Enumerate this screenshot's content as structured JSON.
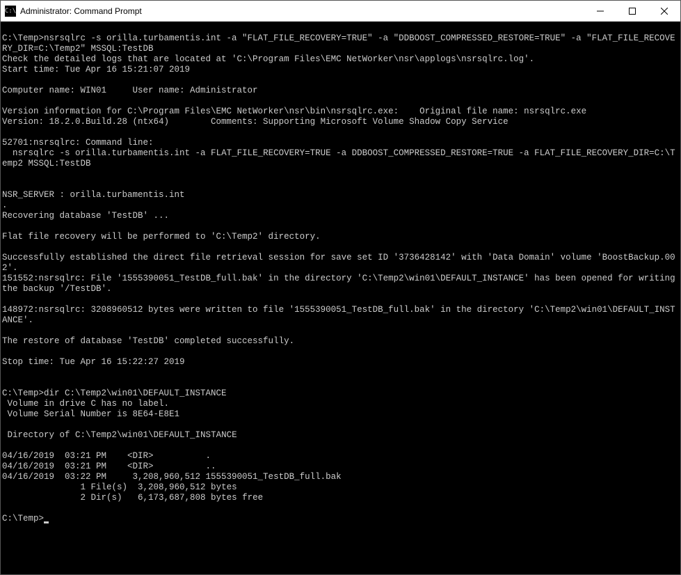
{
  "window": {
    "title": "Administrator: Command Prompt",
    "icon_label": "C:\\"
  },
  "terminal": {
    "lines": [
      "",
      "C:\\Temp>nsrsqlrc -s orilla.turbamentis.int -a \"FLAT_FILE_RECOVERY=TRUE\" -a \"DDBOOST_COMPRESSED_RESTORE=TRUE\" -a \"FLAT_FILE_RECOVERY_DIR=C:\\Temp2\" MSSQL:TestDB",
      "Check the detailed logs that are located at 'C:\\Program Files\\EMC NetWorker\\nsr\\applogs\\nsrsqlrc.log'.",
      "Start time: Tue Apr 16 15:21:07 2019",
      "",
      "Computer name: WIN01     User name: Administrator",
      "",
      "Version information for C:\\Program Files\\EMC NetWorker\\nsr\\bin\\nsrsqlrc.exe:    Original file name: nsrsqlrc.exe",
      "Version: 18.2.0.Build.28 (ntx64)        Comments: Supporting Microsoft Volume Shadow Copy Service",
      "",
      "52701:nsrsqlrc: Command line:",
      "  nsrsqlrc -s orilla.turbamentis.int -a FLAT_FILE_RECOVERY=TRUE -a DDBOOST_COMPRESSED_RESTORE=TRUE -a FLAT_FILE_RECOVERY_DIR=C:\\Temp2 MSSQL:TestDB",
      "",
      "",
      "NSR_SERVER : orilla.turbamentis.int",
      ".",
      "Recovering database 'TestDB' ...",
      "",
      "Flat file recovery will be performed to 'C:\\Temp2' directory.",
      "",
      "Successfully established the direct file retrieval session for save set ID '3736428142' with 'Data Domain' volume 'BoostBackup.002'.",
      "151552:nsrsqlrc: File '1555390051_TestDB_full.bak' in the directory 'C:\\Temp2\\win01\\DEFAULT_INSTANCE' has been opened for writing the backup '/TestDB'.",
      "",
      "148972:nsrsqlrc: 3208960512 bytes were written to file '1555390051_TestDB_full.bak' in the directory 'C:\\Temp2\\win01\\DEFAULT_INSTANCE'.",
      "",
      "The restore of database 'TestDB' completed successfully.",
      "",
      "Stop time: Tue Apr 16 15:22:27 2019",
      "",
      "",
      "C:\\Temp>dir C:\\Temp2\\win01\\DEFAULT_INSTANCE",
      " Volume in drive C has no label.",
      " Volume Serial Number is 8E64-E8E1",
      "",
      " Directory of C:\\Temp2\\win01\\DEFAULT_INSTANCE",
      "",
      "04/16/2019  03:21 PM    <DIR>          .",
      "04/16/2019  03:21 PM    <DIR>          ..",
      "04/16/2019  03:22 PM     3,208,960,512 1555390051_TestDB_full.bak",
      "               1 File(s)  3,208,960,512 bytes",
      "               2 Dir(s)   6,173,687,808 bytes free",
      "",
      "C:\\Temp>"
    ]
  }
}
